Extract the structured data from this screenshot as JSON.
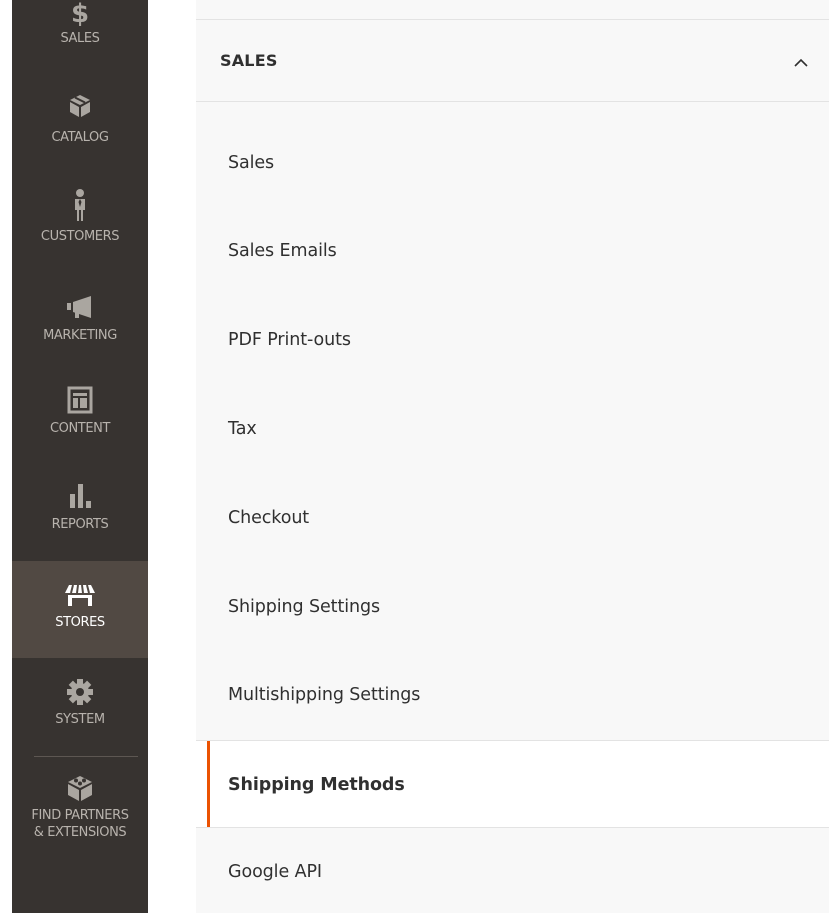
{
  "sidebar": {
    "items": [
      {
        "label": "SALES",
        "icon": "dollar-icon"
      },
      {
        "label": "CATALOG",
        "icon": "cube-icon"
      },
      {
        "label": "CUSTOMERS",
        "icon": "person-icon"
      },
      {
        "label": "MARKETING",
        "icon": "megaphone-icon"
      },
      {
        "label": "CONTENT",
        "icon": "layout-icon"
      },
      {
        "label": "REPORTS",
        "icon": "bar-chart-icon"
      },
      {
        "label": "STORES",
        "icon": "storefront-icon",
        "active": true
      },
      {
        "label": "SYSTEM",
        "icon": "gear-icon"
      },
      {
        "label": "FIND PARTNERS\n& EXTENSIONS",
        "icon": "blocks-icon"
      }
    ]
  },
  "section": {
    "title": "SALES",
    "expanded": true
  },
  "menu": {
    "items": [
      "Sales",
      "Sales Emails",
      "PDF Print-outs",
      "Tax",
      "Checkout",
      "Shipping Settings",
      "Multishipping Settings",
      "Shipping Methods",
      "Google API"
    ],
    "active": "Shipping Methods"
  },
  "colors": {
    "sidebar_bg": "#373330",
    "sidebar_active_bg": "#514943",
    "accent": "#eb5202",
    "panel_bg": "#f8f8f8",
    "text": "#303030"
  }
}
